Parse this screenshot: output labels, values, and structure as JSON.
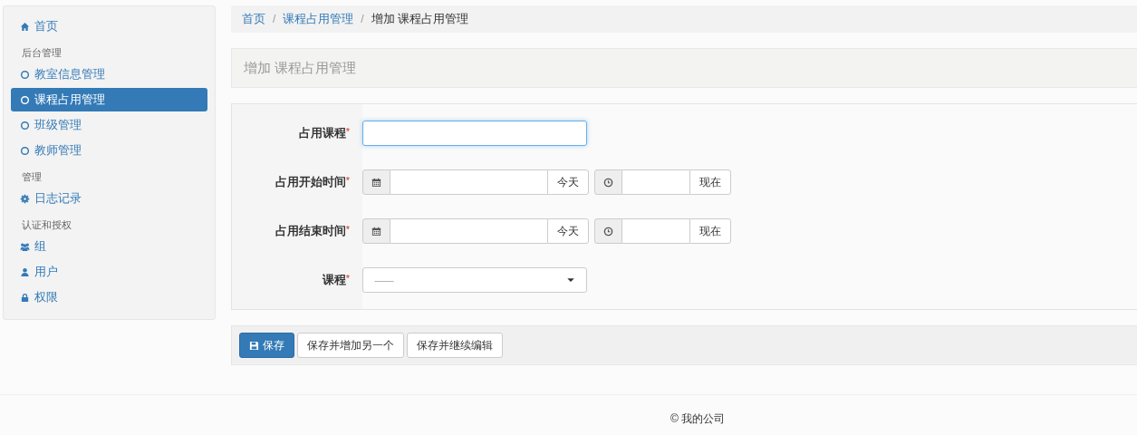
{
  "sidebar": {
    "items": [
      {
        "kind": "home",
        "label": "首页",
        "selected": false
      },
      {
        "kind": "header",
        "label": "后台管理"
      },
      {
        "kind": "circle",
        "label": "教室信息管理",
        "selected": false
      },
      {
        "kind": "circle",
        "label": "课程占用管理",
        "selected": true
      },
      {
        "kind": "circle",
        "label": "班级管理",
        "selected": false
      },
      {
        "kind": "circle",
        "label": "教师管理",
        "selected": false
      },
      {
        "kind": "header",
        "label": "管理"
      },
      {
        "kind": "gear",
        "label": "日志记录",
        "selected": false
      },
      {
        "kind": "header",
        "label": "认证和授权"
      },
      {
        "kind": "group",
        "label": "组",
        "selected": false
      },
      {
        "kind": "user",
        "label": "用户",
        "selected": false
      },
      {
        "kind": "lock",
        "label": "权限",
        "selected": false
      }
    ]
  },
  "breadcrumb": [
    {
      "label": "首页",
      "link": true
    },
    {
      "separator": "/",
      "label": "课程占用管理",
      "link": true
    },
    {
      "separator": "/",
      "label": "增加 课程占用管理",
      "link": false
    }
  ],
  "page_title": "增加 课程占用管理",
  "form": {
    "fields": [
      {
        "kind": "text",
        "label": "占用课程",
        "required_mark": "*",
        "focused": true
      },
      {
        "kind": "datetime",
        "label": "占用开始时间",
        "required_mark": "*",
        "today": "今天",
        "now": "现在"
      },
      {
        "kind": "datetime",
        "label": "占用结束时间",
        "required_mark": "*",
        "today": "今天",
        "now": "现在"
      },
      {
        "kind": "select",
        "label": "课程",
        "required_mark": "*",
        "value": "---------"
      }
    ]
  },
  "buttons": [
    {
      "label": "保存",
      "primary": true
    },
    {
      "label": "保存并增加另一个",
      "primary": false
    },
    {
      "label": "保存并继续编辑",
      "primary": false
    }
  ],
  "footer": "© 我的公司"
}
